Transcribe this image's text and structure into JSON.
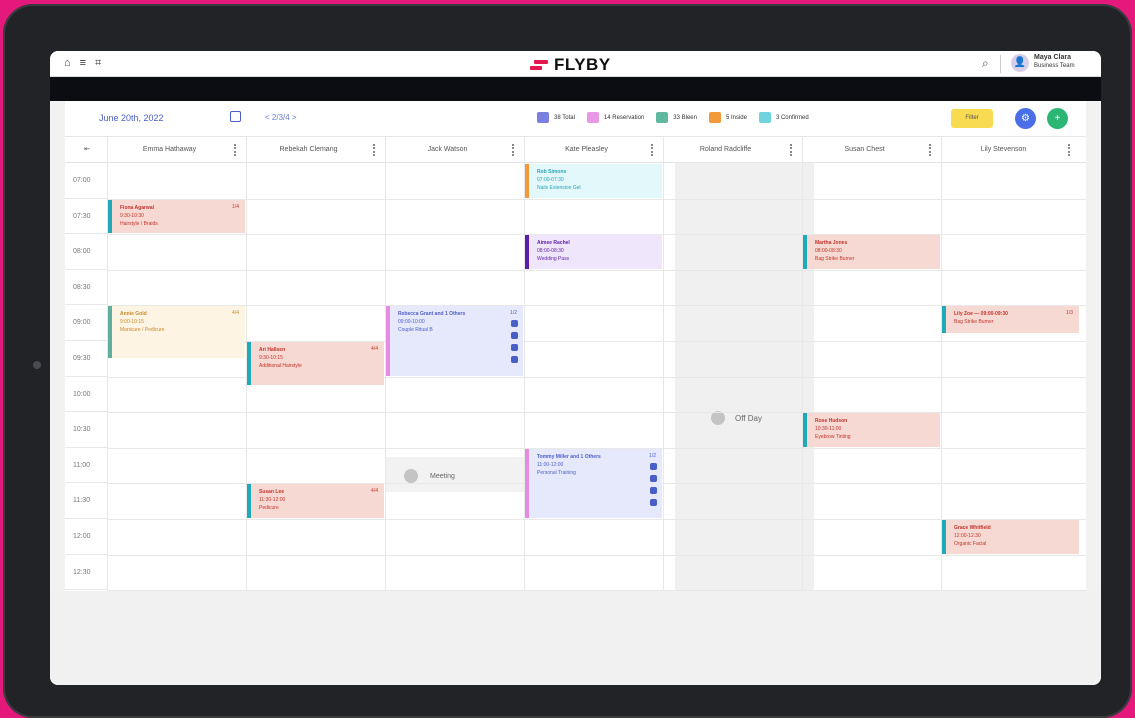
{
  "app": {
    "logo_text": "FLYBY",
    "user_name": "Maya Clara",
    "user_role": "Business Team"
  },
  "topbar_icons": [
    "home-icon",
    "layers-icon",
    "grid-icon"
  ],
  "toolbar": {
    "date": "June 20th, 2022",
    "nav_label": "< 2/3/4 >",
    "legend": [
      {
        "label": "38 Total",
        "color": "#7b7fe0"
      },
      {
        "label": "14 Reservation",
        "color": "#e79ae3"
      },
      {
        "label": "33 Bleen",
        "color": "#5fb8a0"
      },
      {
        "label": "5 Inside",
        "color": "#f29a3a"
      },
      {
        "label": "3 Confirmed",
        "color": "#6fd3e0"
      }
    ],
    "filter_label": "Filter"
  },
  "columns": [
    {
      "name": "Emma Hathaway"
    },
    {
      "name": "Rebekah Clemang"
    },
    {
      "name": "Jack Watson"
    },
    {
      "name": "Kate Pleasley"
    },
    {
      "name": "Roland Radcliffe"
    },
    {
      "name": "Susan Chest"
    },
    {
      "name": "Lily Stevenson"
    }
  ],
  "times": [
    "07:00",
    "07:30",
    "08:00",
    "08:30",
    "09:00",
    "09:30",
    "10:00",
    "10:30",
    "11:00",
    "11:30",
    "12:00",
    "12:30"
  ],
  "off_day_label": "Off Day",
  "meeting_label": "Meeting",
  "events": [
    {
      "col": 0,
      "start": 1,
      "span": 1,
      "color": "#f7d9d4",
      "border": "#20a9b8",
      "text_color": "#c0342a",
      "lines": [
        "Fiona Agarwal",
        "9:30-10:30",
        "Hairstyle / Braids"
      ],
      "badge": "1/4"
    },
    {
      "col": 0,
      "start": 4,
      "span": 1.5,
      "color": "#fdf4e3",
      "border": "#5fae9f",
      "text_color": "#c8892d",
      "lines": [
        "Annie Gold",
        "9:00-10:15",
        "Manicure / Pedicure"
      ],
      "badge": "4/4"
    },
    {
      "col": 1,
      "start": 5,
      "span": 1.25,
      "color": "#f7d9d4",
      "border": "#20a9b8",
      "text_color": "#c0342a",
      "lines": [
        "Ari Hallsen",
        "9:30-10:15",
        "Additional Hairstyle"
      ],
      "badge": "4/4"
    },
    {
      "col": 1,
      "start": 9,
      "span": 1,
      "color": "#f7d9d4",
      "border": "#20a9b8",
      "text_color": "#c0342a",
      "lines": [
        "Susan Lee",
        "11:30-12:00",
        "Pedicure"
      ],
      "badge": "4/4"
    },
    {
      "col": 2,
      "start": 4,
      "span": 2,
      "color": "#e6e8fb",
      "border": "#e58be0",
      "text_color": "#5060c8",
      "lines": [
        "Rebecca Grant and 1 Others",
        "09:00-10:00",
        "Couple Ritual B"
      ],
      "badge": "1/2",
      "icons": true
    },
    {
      "col": 3,
      "start": 0,
      "span": 1,
      "color": "#e3f8fa",
      "border": "#f29a3a",
      "text_color": "#2aa3b5",
      "lines": [
        "Rob Simons",
        "07:00-07:30",
        "Nails Extension Gel"
      ]
    },
    {
      "col": 3,
      "start": 2,
      "span": 1,
      "color": "#f0e6fb",
      "border": "#5a1fa8",
      "text_color": "#5a1fa8",
      "lines": [
        "Aimee Rachel",
        "08:00-08:30",
        "Wedding Pass"
      ]
    },
    {
      "col": 3,
      "start": 8,
      "span": 2,
      "color": "#e6e8fb",
      "border": "#e58be0",
      "text_color": "#5060c8",
      "lines": [
        "Tommy Miller and 1 Others",
        "11:00-12:00",
        "Personal Training"
      ],
      "badge": "1/2",
      "icons": true
    },
    {
      "col": 5,
      "start": 2,
      "span": 1,
      "color": "#f7d9d4",
      "border": "#20a9b8",
      "text_color": "#c0342a",
      "lines": [
        "Martha Jones",
        "08:00-08:30",
        "Bag Strike Burner"
      ]
    },
    {
      "col": 5,
      "start": 7,
      "span": 1,
      "color": "#f7d9d4",
      "border": "#20a9b8",
      "text_color": "#c0342a",
      "lines": [
        "Rose Hudson",
        "10:30-11:00",
        "Eyebrow Tinting"
      ]
    },
    {
      "col": 6,
      "start": 4,
      "span": 0.8,
      "color": "#f7d9d4",
      "border": "#20a9b8",
      "text_color": "#c0342a",
      "lines": [
        "Lily Zoe  —  09:00-09:30",
        "Bag Strike Burner"
      ],
      "badge": "1/3"
    },
    {
      "col": 6,
      "start": 10,
      "span": 1,
      "color": "#f7d9d4",
      "border": "#20a9b8",
      "text_color": "#c0342a",
      "lines": [
        "Grace Whitfield",
        "12:00-12:30",
        "Organic Facial"
      ]
    }
  ]
}
